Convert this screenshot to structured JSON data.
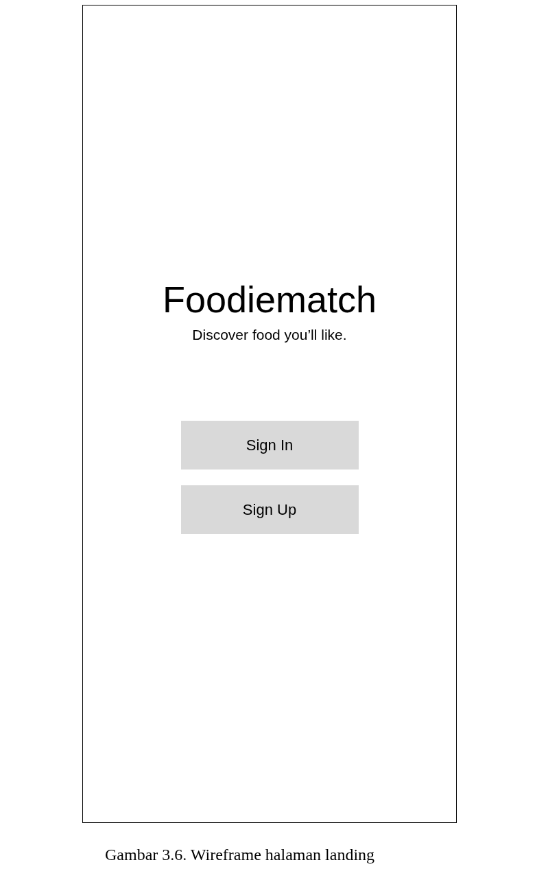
{
  "wireframe": {
    "title": "Foodiematch",
    "tagline": "Discover food you’ll like.",
    "buttons": [
      {
        "label": "Sign In"
      },
      {
        "label": "Sign Up"
      }
    ]
  },
  "caption": "Gambar 3.6. Wireframe halaman landing"
}
